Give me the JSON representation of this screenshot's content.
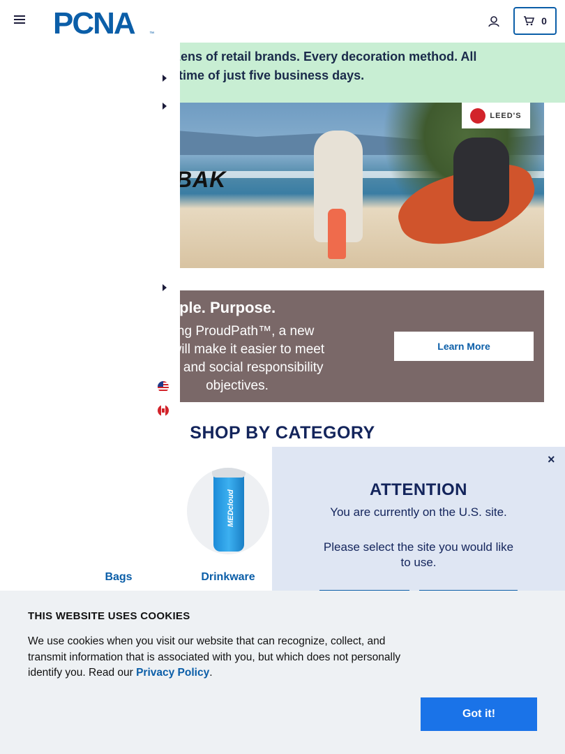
{
  "header": {
    "logo_text": "PCNA",
    "logo_tm": "™",
    "cart_count": "0",
    "icons": {
      "menu": "hamburger-menu-icon",
      "account": "user-icon",
      "cart": "shopping-cart-icon"
    }
  },
  "promo": {
    "line1": "roducts. Dozens of retail brands. Every decoration method. All",
    "line2": "andard lead time of just five business days."
  },
  "hero": {
    "brand_left": "BAK",
    "brand_badge": "LEED'S"
  },
  "proudpath": {
    "title": "et. People. Purpose.",
    "body_line1": "ucing ProudPath™, a new",
    "body_line2": "hat will make it easier to meet",
    "body_line3": "ental and social responsibility",
    "body_line4": "objectives.",
    "button": "Learn More"
  },
  "shop": {
    "title": "SHOP BY CATEGORY",
    "categories": [
      {
        "label": "Bags"
      },
      {
        "label": "Drinkware",
        "product_text": "MEDcloud"
      }
    ]
  },
  "attention": {
    "close": "×",
    "title": "ATTENTION",
    "message": "You are currently on the U.S. site.",
    "prompt": "Please select the site you would like to use."
  },
  "cookie": {
    "title": "THIS WEBSITE USES COOKIES",
    "text": "We use cookies when you visit our website that can recognize, collect, and transmit information that is associated with you, but which does not personally identify you. Read our ",
    "link": "Privacy Policy",
    "end": ".",
    "button": "Got it!"
  },
  "colors": {
    "brand_blue": "#0b5ea8",
    "navy": "#13245b",
    "promo_green": "#c8eed3",
    "banner_brown": "#7a6868",
    "cookie_button": "#1a73e8"
  }
}
